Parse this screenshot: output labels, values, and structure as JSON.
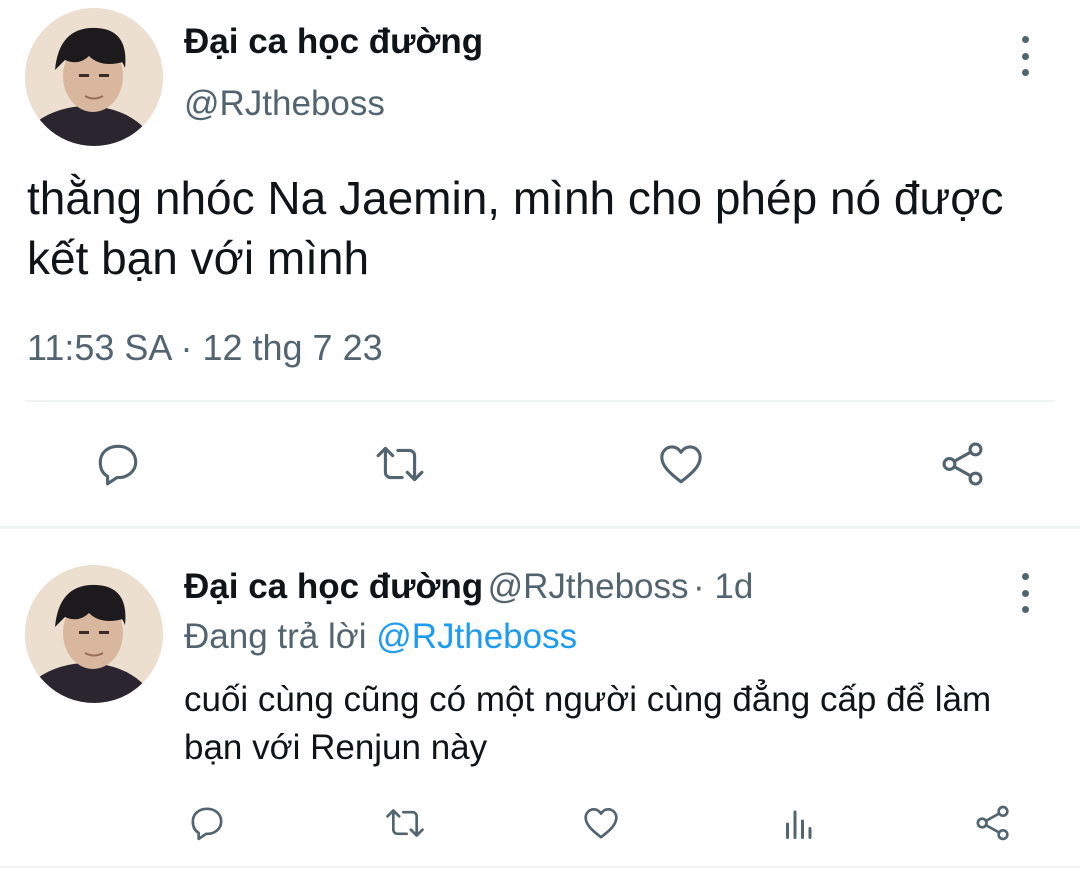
{
  "tweet": {
    "display_name": "Đại ca học đường",
    "handle": "@RJtheboss",
    "text": "thằng nhóc Na Jaemin, mình cho phép nó được kết bạn với mình",
    "timestamp": "11:53 SA · 12 thg 7 23",
    "avatar": "avatar-image",
    "actions": [
      "reply-icon",
      "retweet-icon",
      "like-icon",
      "share-icon"
    ]
  },
  "reply": {
    "display_name": "Đại ca học đường",
    "handle": "@RJtheboss",
    "time": "· 1d",
    "replying_prefix": "Đang trả lời",
    "replying_to": "@RJtheboss",
    "text": "cuối cùng cũng có một người cùng đẳng cấp để làm bạn với Renjun này",
    "avatar": "avatar-image",
    "actions": [
      "reply-icon",
      "retweet-icon",
      "like-icon",
      "analytics-icon",
      "share-icon"
    ]
  },
  "colors": {
    "text": "#0f1419",
    "secondary": "#536471",
    "link": "#1d9bf0",
    "divider": "#eff3f4"
  }
}
